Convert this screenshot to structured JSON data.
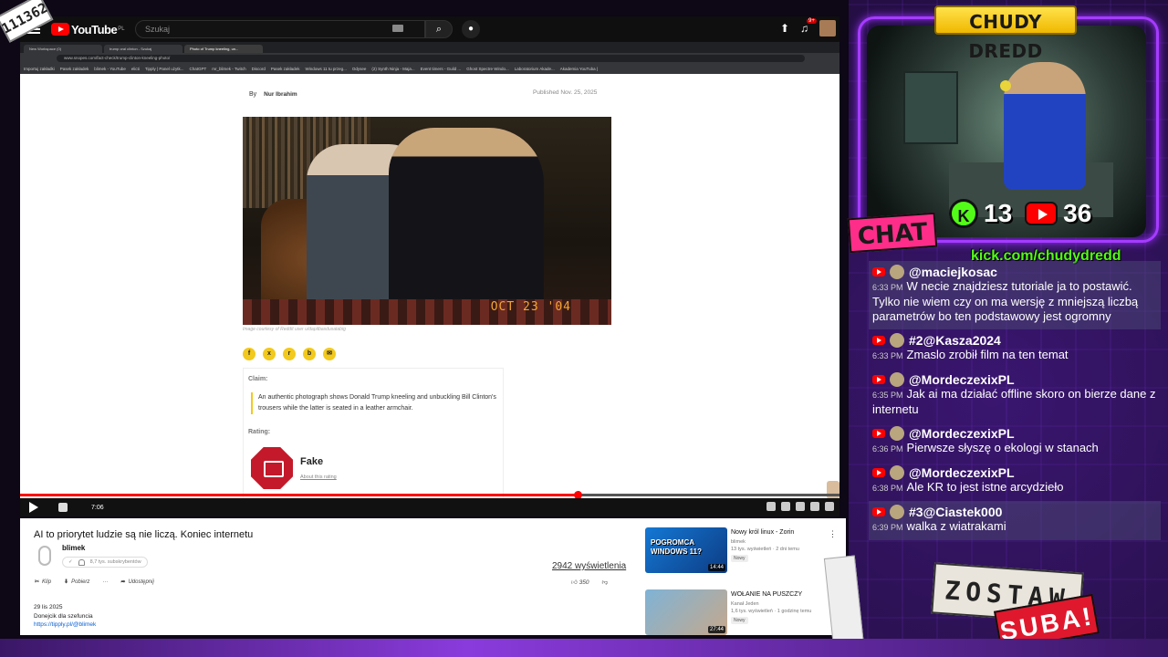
{
  "stream": {
    "sub_counter": "111362",
    "streamer_name": "CHUDY DREDD",
    "kick_viewers": "13",
    "yt_viewers": "36",
    "chat_tag": "CHAT",
    "kick_url": "kick.com/chudydredd",
    "zostaw": "ZOSTAW",
    "suba": "SUBA!"
  },
  "youtube": {
    "logo_text": "YouTube",
    "logo_region": "PL",
    "search_placeholder": "Szukaj",
    "notif_count": "9+"
  },
  "browser": {
    "tabs": [
      "New Workspace (0)",
      "trump oral clinton - Szukaj",
      "Photo of Trump kneeling, un..."
    ],
    "address": "www.snopes.com/fact-check/trump-clinton-kneeling-photo/",
    "bookmarks": [
      "Importuj zakładki",
      "Pasek zakładek",
      "blimek - YouTube",
      "elicti",
      "Tipply | Panel użytk...",
      "ChatGPT",
      "mr_blimek - Twitch",
      "Discord",
      "Pasek zakładek",
      "Windows 11 tu przeg...",
      "Odysee",
      "(2) Synth Ninja - Maja...",
      "Event timers - Guild ...",
      "Ghost Spectre Windo...",
      "Laboratorium Akade...",
      "Akademia YouTuba |"
    ]
  },
  "article": {
    "by_label": "By",
    "author": "Nur Ibrahim",
    "published": "Published Nov. 25, 2025",
    "photo_stamp": "OCT 23 '04",
    "caption": "Image courtesy of Reddit user u/dapitbasdusatabig",
    "claim_label": "Claim:",
    "claim_text": "An authentic photograph shows Donald Trump kneeling and unbuckling Bill Clinton's trousers while the latter is seated in a leather armchair.",
    "rating_label": "Rating:",
    "rating_name": "Fake",
    "rating_link": "About this rating"
  },
  "player": {
    "progress": 0.68,
    "time": "7:06"
  },
  "video": {
    "title": "AI to priorytet ludzie są nie liczą. Koniec internetu",
    "channel": "blimek",
    "subscribers": "8,7 tys. subskrybentów",
    "views": "2942 wyświetlenia",
    "clip_label": "Klip",
    "download_label": "Pobierz",
    "share_label": "Udostępnij",
    "likes": "350",
    "desc_date": "29 lis 2025",
    "desc_text": "Donejcik dla szefuncia",
    "desc_link": "https://tipply.pl/@blimek"
  },
  "suggestions": [
    {
      "thumb_text": "POGROMCA WINDOWS 11?",
      "duration": "14:44",
      "title": "Nowy król linux - Zorin",
      "channel": "blimek",
      "meta": "13 tys. wyświetleń · 2 dni temu",
      "badge": "Nowy"
    },
    {
      "thumb_text": "",
      "duration": "27:44",
      "title": "WOŁANIE NA PUSZCZY",
      "channel": "Kanał Jeden",
      "meta": "1,6 tys. wyświetleń · 1 godzinę temu",
      "badge": "Nowy"
    }
  ],
  "chat": [
    {
      "user": "@maciejkosac",
      "time": "6:33 PM",
      "text": "W necie znajdziesz tutoriale ja to postawić. Tylko nie wiem czy on ma wersję z mniejszą liczbą parametrów bo ten podstawowy jest ogromny",
      "hl": true
    },
    {
      "user": "#2@Kasza2024",
      "time": "6:33 PM",
      "text": "Zmaslo zrobił film na ten temat",
      "hl": false
    },
    {
      "user": "@MordeczexixPL",
      "time": "6:35 PM",
      "text": "Jak ai ma działać offline skoro on bierze dane z internetu",
      "hl": false
    },
    {
      "user": "@MordeczexixPL",
      "time": "6:36 PM",
      "text": "Pierwsze słyszę o ekologi w stanach",
      "hl": false
    },
    {
      "user": "@MordeczexixPL",
      "time": "6:38 PM",
      "text": "Ale KR to jest istne arcydzieło",
      "hl": false
    },
    {
      "user": "#3@Ciastek000",
      "time": "6:39 PM",
      "text": "walka z wiatrakami",
      "hl": true
    }
  ]
}
